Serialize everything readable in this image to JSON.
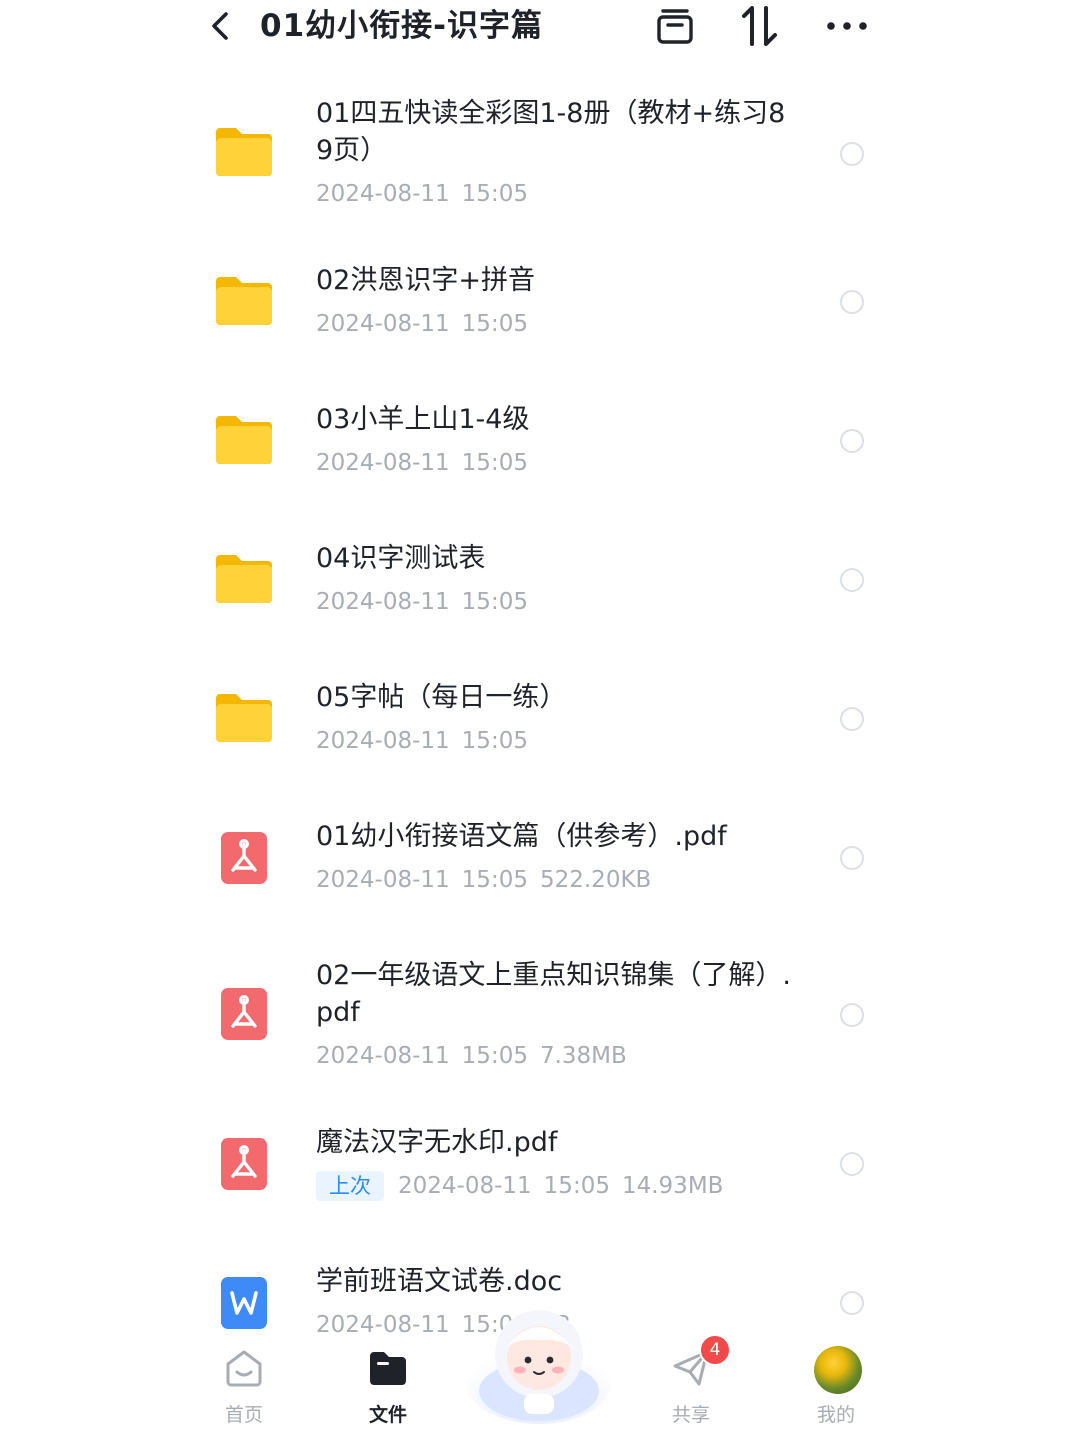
{
  "header": {
    "title": "01幼小衔接-识字篇",
    "back_icon": "chevron-left-icon",
    "actions": [
      "archive-icon",
      "sort-icon",
      "more-icon"
    ]
  },
  "files": [
    {
      "name": "01四五快读全彩图1-8册（教材+练习89页）",
      "type": "folder",
      "date": "2024-08-11",
      "time": "15:05",
      "size": ""
    },
    {
      "name": "02洪恩识字+拼音",
      "type": "folder",
      "date": "2024-08-11",
      "time": "15:05",
      "size": ""
    },
    {
      "name": "03小羊上山1-4级",
      "type": "folder",
      "date": "2024-08-11",
      "time": "15:05",
      "size": ""
    },
    {
      "name": "04识字测试表",
      "type": "folder",
      "date": "2024-08-11",
      "time": "15:05",
      "size": ""
    },
    {
      "name": "05字帖（每日一练）",
      "type": "folder",
      "date": "2024-08-11",
      "time": "15:05",
      "size": ""
    },
    {
      "name": "01幼小衔接语文篇（供参考）.pdf",
      "type": "pdf",
      "date": "2024-08-11",
      "time": "15:05",
      "size": "522.20KB"
    },
    {
      "name": "02一年级语文上重点知识锦集（了解）.pdf",
      "type": "pdf",
      "date": "2024-08-11",
      "time": "15:05",
      "size": "7.38MB"
    },
    {
      "name": "魔法汉字无水印.pdf",
      "type": "pdf",
      "badge": "上次",
      "date": "2024-08-11",
      "time": "15:05",
      "size": "14.93MB"
    },
    {
      "name": "学前班语文试卷.doc",
      "type": "doc",
      "date": "2024-08-11",
      "time": "15:0",
      "size": "0KB"
    }
  ],
  "nav": {
    "items": [
      {
        "label": "首页",
        "icon": "home-icon"
      },
      {
        "label": "文件",
        "icon": "folder-icon",
        "active": true
      },
      {
        "label": "共享",
        "icon": "share-plane-icon",
        "badge": "4"
      },
      {
        "label": "我的",
        "icon": "avatar"
      }
    ]
  },
  "colors": {
    "folder": "#FFCE2E",
    "pdf": "#F26A6E",
    "doc": "#3E8BF7",
    "badge": "#F14A4A",
    "accent": "#2B8CF4"
  }
}
